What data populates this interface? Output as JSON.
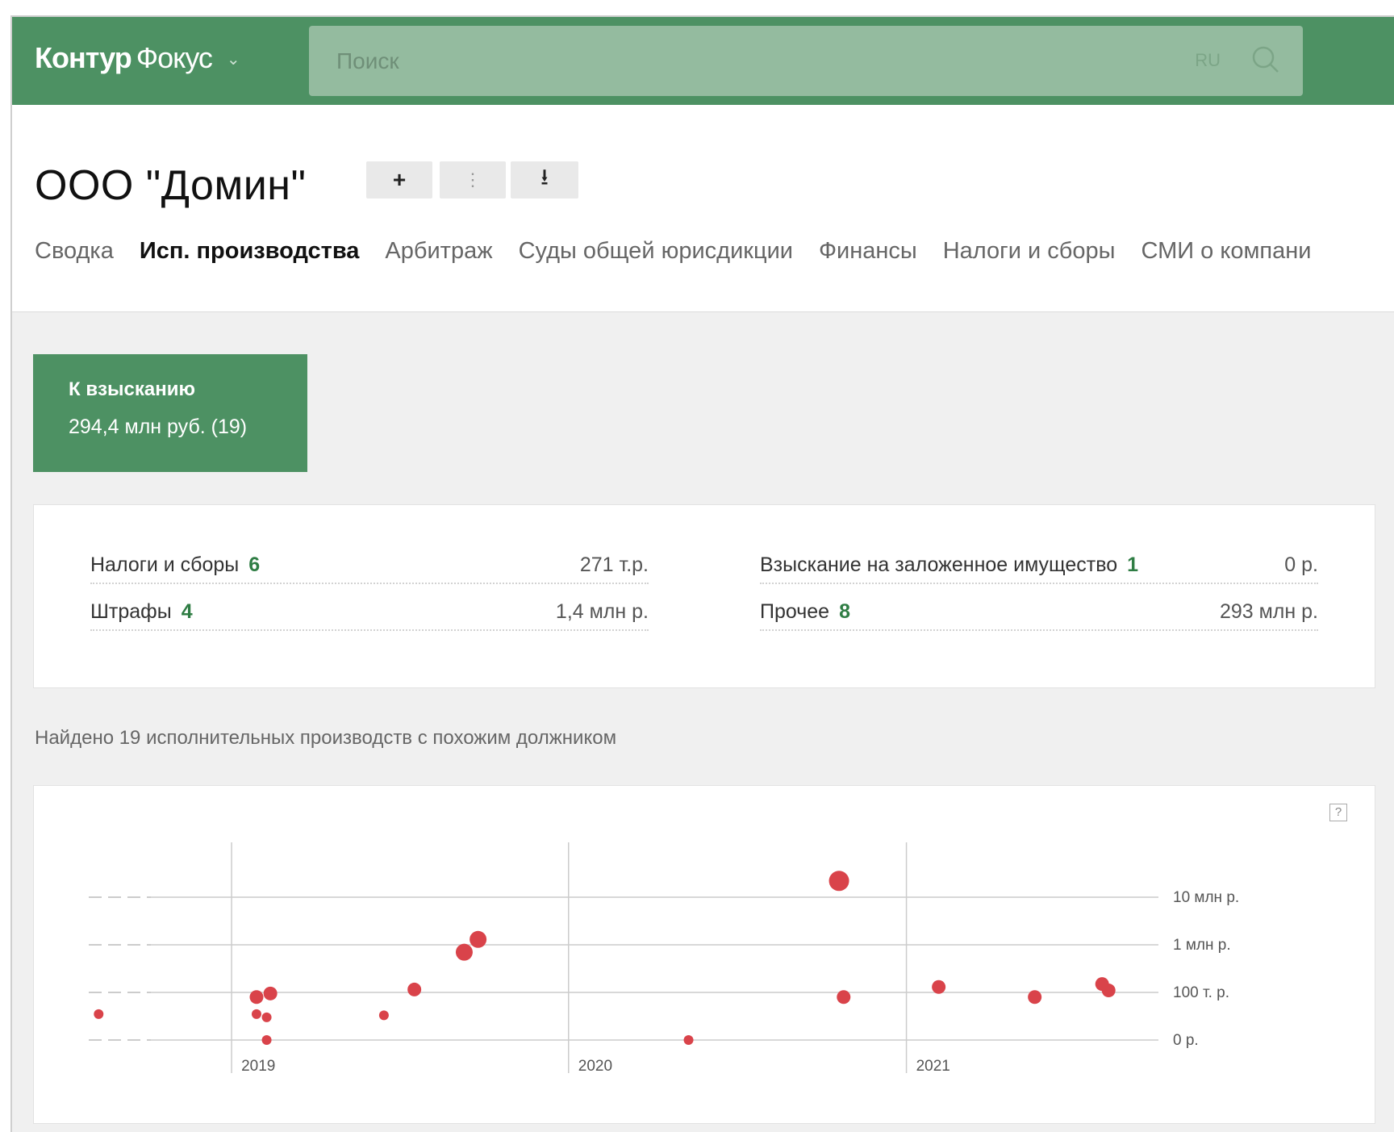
{
  "app": {
    "brand_part1": "Контур",
    "brand_part2": "Фокус",
    "brand_chevron": "⌄",
    "search_placeholder": "Поиск",
    "search_lang": "RU",
    "accent_color": "#4d9163"
  },
  "company": {
    "title": "ООО \"Домин\"",
    "actions": {
      "add_label": "+",
      "compare_label": "⋮",
      "download_label": "⭳"
    }
  },
  "tabs": [
    {
      "label": "Сводка",
      "active": false
    },
    {
      "label": "Исп. производства",
      "active": true
    },
    {
      "label": "Арбитраж",
      "active": false
    },
    {
      "label": "Суды общей юрисдикции",
      "active": false
    },
    {
      "label": "Финансы",
      "active": false
    },
    {
      "label": "Налоги и сборы",
      "active": false
    },
    {
      "label": "СМИ о компани",
      "active": false
    }
  ],
  "summary_tile": {
    "title": "К взысканию",
    "value": "294,4 млн руб. (19)"
  },
  "breakdown": [
    {
      "label": "Налоги и сборы",
      "count": "6",
      "amount": "271 т.р."
    },
    {
      "label": "Штрафы",
      "count": "4",
      "amount": "1,4 млн р."
    },
    {
      "label": "Взыскание на заложенное имущество",
      "count": "1",
      "amount": "0 р."
    },
    {
      "label": "Прочее",
      "count": "8",
      "amount": "293 млн р."
    }
  ],
  "found_text": "Найдено 19 исполнительных производств с похожим должником",
  "help_glyph": "?",
  "chart_data": {
    "type": "scatter",
    "y_scale": "log",
    "y_tick_labels": [
      "10 млн р.",
      "1 млн р.",
      "100 т. р.",
      "0 р."
    ],
    "y_tick_values": [
      10000000,
      1000000,
      100000,
      0
    ],
    "x_tick_labels": [
      "2019",
      "2020",
      "2021"
    ],
    "x_tick_values": [
      "2019-01-01",
      "2020-01-01",
      "2021-01-01"
    ],
    "x_range": [
      "2018-08-01",
      "2021-10-01"
    ],
    "grid": true,
    "point_color": "#d9434a",
    "points": [
      {
        "x": "2018-08-10",
        "y": 35000,
        "size": "small"
      },
      {
        "x": "2019-01-28",
        "y": 80000,
        "size": "medium"
      },
      {
        "x": "2019-02-12",
        "y": 95000,
        "size": "medium"
      },
      {
        "x": "2019-01-28",
        "y": 35000,
        "size": "small"
      },
      {
        "x": "2019-02-08",
        "y": 30000,
        "size": "small"
      },
      {
        "x": "2019-02-08",
        "y": 0,
        "size": "small"
      },
      {
        "x": "2019-06-15",
        "y": 33000,
        "size": "small"
      },
      {
        "x": "2019-07-18",
        "y": 115000,
        "size": "medium"
      },
      {
        "x": "2019-09-10",
        "y": 700000,
        "size": "large"
      },
      {
        "x": "2019-09-25",
        "y": 1300000,
        "size": "large"
      },
      {
        "x": "2020-05-10",
        "y": 0,
        "size": "small"
      },
      {
        "x": "2020-10-20",
        "y": 22000000,
        "size": "xlarge"
      },
      {
        "x": "2020-10-25",
        "y": 80000,
        "size": "medium"
      },
      {
        "x": "2021-02-05",
        "y": 130000,
        "size": "medium"
      },
      {
        "x": "2021-05-20",
        "y": 80000,
        "size": "medium"
      },
      {
        "x": "2021-08-01",
        "y": 150000,
        "size": "medium"
      },
      {
        "x": "2021-08-08",
        "y": 110000,
        "size": "medium"
      }
    ]
  }
}
